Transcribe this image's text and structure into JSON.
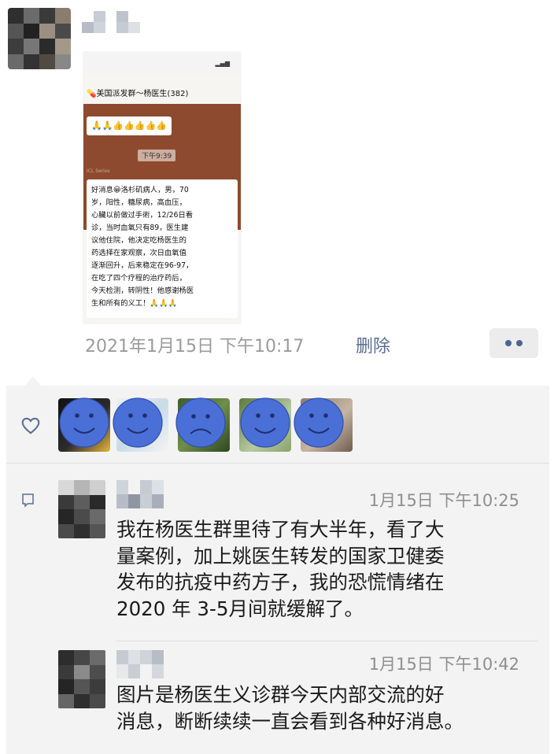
{
  "post": {
    "date": "2021年1月15日 下午10:17",
    "delete_label": "删除"
  },
  "screenshot": {
    "group_title": "美国派发群～杨医生(382)",
    "thumbs": "🙏🙏👍👍👍👍👍",
    "time_tag": "下午9:39",
    "caption": "ICL Series",
    "message": "好消息😀洛杉矶病人，男，70\n岁，阳性，糖尿病，高血压，\n心臟以前做过手術，12/26日看\n诊，当时血氧只有89，医生建\n议他住院，他决定吃杨医生的\n药选择在家观察，次日血氧值\n逐渐回升，后来稳定在96-97，\n在吃了四个疗程的治疗药后，\n今天检测，转阴性！他感谢杨医\n生和所有的义工！🙏🙏🙏"
  },
  "likes": {
    "faces": [
      "smile",
      "smile",
      "sad",
      "smile",
      "smile"
    ],
    "face_color": "#4a6fd6"
  },
  "comments": [
    {
      "time": "1月15日 下午10:25",
      "text_lines": [
        "我在杨医生群里待了有大半年，看了大",
        "量案例，加上姚医生转发的国家卫健委",
        "发布的抗疫中药方子，我的恐慌情绪在",
        "2020 年 3-5月间就缓解了。"
      ]
    },
    {
      "time": "1月15日 下午10:42",
      "text_lines": [
        "图片是杨医生义诊群今天内部交流的好",
        "消息，断断续续一直会看到各种好消息。"
      ]
    }
  ],
  "colors": {
    "link_blue": "#5a6d94",
    "muted_gray": "#9b9b9b",
    "panel_bg": "#f3f3f3"
  }
}
